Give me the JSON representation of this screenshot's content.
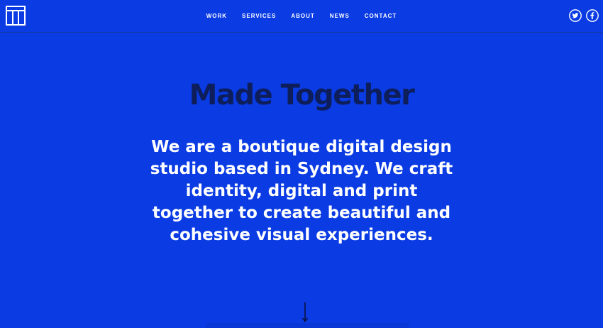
{
  "brand": {
    "logo_icon": "t-monogram-logo-icon"
  },
  "nav": {
    "items": [
      {
        "label": "WORK"
      },
      {
        "label": "SERVICES"
      },
      {
        "label": "ABOUT"
      },
      {
        "label": "NEWS"
      },
      {
        "label": "CONTACT"
      }
    ]
  },
  "social": {
    "items": [
      {
        "icon": "twitter-icon"
      },
      {
        "icon": "facebook-icon"
      }
    ]
  },
  "hero": {
    "headline": "Made Together",
    "intro": "We are a boutique digital design studio based in Sydney. We craft identity, digital and print together to create beautiful and cohesive visual experiences.",
    "scroll_icon": "arrow-down-icon"
  },
  "colors": {
    "background": "#0a3be3",
    "headline": "#0d1e5a",
    "text": "#ffffff"
  }
}
